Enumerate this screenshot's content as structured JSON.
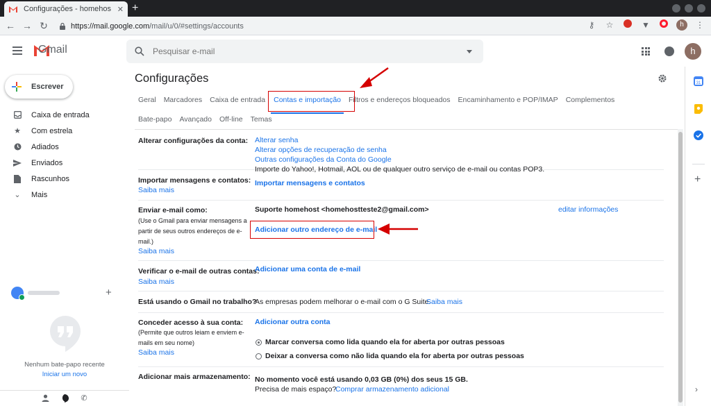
{
  "browser": {
    "tab_title": "Configurações - homehos",
    "tab_close": "✕",
    "newtab": "+",
    "url_host": "https://mail.google.com",
    "url_path": "/mail/u/0/#settings/accounts",
    "profile_initial": "h"
  },
  "header": {
    "app_name": "Gmail",
    "search_placeholder": "Pesquisar e-mail",
    "avatar_initial": "h"
  },
  "sidebar": {
    "compose_label": "Escrever",
    "items": [
      {
        "label": "Caixa de entrada",
        "icon": "inbox-icon"
      },
      {
        "label": "Com estrela",
        "icon": "star-icon"
      },
      {
        "label": "Adiados",
        "icon": "clock-icon"
      },
      {
        "label": "Enviados",
        "icon": "send-icon"
      },
      {
        "label": "Rascunhos",
        "icon": "draft-icon"
      },
      {
        "label": "Mais",
        "icon": "chevron-down-icon"
      }
    ],
    "chat_add": "+",
    "no_chat": "Nenhum bate-papo recente",
    "start_new": "Iniciar um novo"
  },
  "settings": {
    "title": "Configurações",
    "tabs_row1": [
      "Geral",
      "Marcadores",
      "Caixa de entrada",
      "Contas e importação",
      "Filtros e endereços bloqueados",
      "Encaminhamento e POP/IMAP",
      "Complementos"
    ],
    "tabs_row2": [
      "Bate-papo",
      "Avançado",
      "Off-line",
      "Temas"
    ],
    "rows": {
      "account": {
        "label": "Alterar configurações da conta:",
        "links": [
          "Alterar senha",
          "Alterar opções de recuperação de senha",
          "Outras configurações da Conta do Google"
        ]
      },
      "import": {
        "label": "Importar mensagens e contatos:",
        "learn": "Saiba mais",
        "desc": "Importe do Yahoo!, Hotmail, AOL ou de qualquer outro serviço de e-mail ou contas POP3.",
        "action": "Importar mensagens e contatos"
      },
      "sendas": {
        "label": "Enviar e-mail como:",
        "note": "(Use o Gmail para enviar mensagens a partir de seus outros endereços de e-mail.)",
        "learn": "Saiba mais",
        "address": "Suporte homehost <homehostteste2@gmail.com>",
        "edit": "editar informações",
        "add": "Adicionar outro endereço de e-mail"
      },
      "check": {
        "label": "Verificar o e-mail de outras contas:",
        "learn": "Saiba mais",
        "action": "Adicionar uma conta de e-mail"
      },
      "work": {
        "label": "Está usando o Gmail no trabalho?",
        "text": "As empresas podem melhorar o e-mail com o G Suite.",
        "learn": "Saiba mais"
      },
      "grant": {
        "label": "Conceder acesso à sua conta:",
        "note": "(Permite que outros leiam e enviem e-mails em seu nome)",
        "learn": "Saiba mais",
        "action": "Adicionar outra conta",
        "opt1": "Marcar conversa como lida quando ela for aberta por outras pessoas",
        "opt2": "Deixar a conversa como não lida quando ela for aberta por outras pessoas"
      },
      "storage": {
        "label": "Adicionar mais armazenamento:",
        "usage": "No momento você está usando 0,03 GB (0%) dos seus 15 GB.",
        "need": "Precisa de mais espaço?",
        "buy": "Comprar armazenamento adicional"
      }
    }
  },
  "colors": {
    "highlight": "#d50000",
    "link": "#1a73e8",
    "gmail_red": "#ea4335"
  }
}
